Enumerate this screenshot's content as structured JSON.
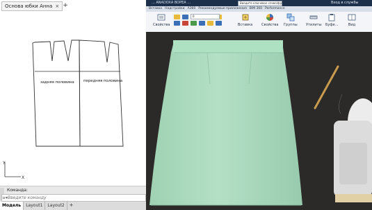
{
  "cad": {
    "file_tab": "Основа юбки Анна",
    "close_symbol": "×",
    "new_tab_symbol": "+",
    "pattern": {
      "back_label": "задняя половина",
      "front_label": "передняя половина"
    },
    "ucs": {
      "x_axis": "X",
      "y_axis": "Y"
    },
    "command": {
      "label": "Команда:",
      "prefix": "≡▾",
      "placeholder": "Введите команду"
    },
    "layout_tabs": [
      {
        "label": "Модель",
        "active": true
      },
      {
        "label": "Layout1",
        "active": false
      },
      {
        "label": "Layout2",
        "active": false
      }
    ],
    "layout_plus": "+"
  },
  "ribbon": {
    "title": "... ANADOXA BOPEA ...",
    "search_text": "Введите ключевое слово/фразу",
    "login": "Вход в службы",
    "tabs": [
      "Вставка",
      "Надстройки",
      "A360",
      "Рекомендуемые приложения",
      "BIM 360",
      "Performance"
    ],
    "layer_value": "0",
    "buttons": {
      "properties": "Свойства",
      "insert": "Вставка",
      "match_properties": "Свойства",
      "groups": "Группы",
      "utilities": "Утилиты",
      "clipboard": "Буфе...",
      "view": "Вид"
    },
    "colors": {
      "titlebar": "#1c2f4b",
      "tool_blue": "#3d6fb6",
      "tool_yellow": "#e8b93a",
      "tool_red": "#c8453a",
      "tool_green": "#4a9a4a"
    }
  },
  "photo": {
    "skirt_color": "#a9d8bc",
    "background_color": "#2b2a28"
  }
}
